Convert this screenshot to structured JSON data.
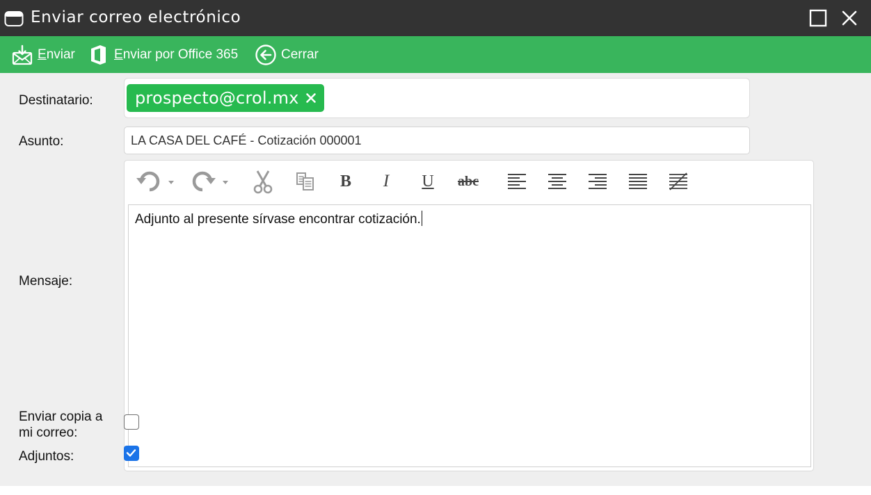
{
  "window": {
    "title": "Enviar correo electrónico"
  },
  "toolbar": {
    "send": {
      "accel": "E",
      "rest": "nviar"
    },
    "send_office": {
      "accel": "E",
      "rest": "nviar por Office 365"
    },
    "close": "Cerrar"
  },
  "form": {
    "recipient_label": "Destinatario:",
    "recipient_chip": "prospecto@crol.mx",
    "subject_label": "Asunto:",
    "subject_value": "LA CASA DEL CAFÉ - Cotización 000001",
    "message_label": "Mensaje:",
    "message_body": "Adjunto al presente sírvase encontrar cotización.",
    "copy_label_line1": "Enviar copia a",
    "copy_label_line2": "mi correo:",
    "copy_checked": false,
    "attachments_label": "Adjuntos:",
    "attachments_checked": true
  },
  "editor_toolbar": {
    "bold_glyph": "B",
    "italic_glyph": "I",
    "underline_glyph": "U",
    "strike_glyph": "abc"
  },
  "colors": {
    "titlebar": "#333333",
    "toolbar": "#39b55c",
    "chip": "#27ba4f",
    "content_bg": "#efefef",
    "checkbox_on": "#1a73e8"
  }
}
